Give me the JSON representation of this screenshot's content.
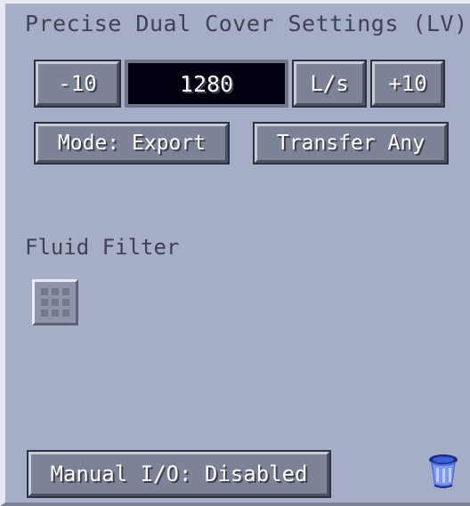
{
  "window": {
    "title": "Precise Dual Cover Settings (LV)"
  },
  "rate": {
    "minus_label": "-10",
    "value": "1280",
    "unit_label": "L/s",
    "plus_label": "+10"
  },
  "modes": {
    "mode_label": "Mode: Export",
    "transfer_label": "Transfer Any"
  },
  "filter": {
    "label": "Fluid Filter",
    "slot_icon": "empty-slot-icon"
  },
  "footer": {
    "manual_io_label": "Manual I/O: Disabled",
    "trash_icon": "trash-can-icon"
  },
  "colors": {
    "panel": "#a6adc6",
    "button": "#7c8396",
    "display_bg": "#000010",
    "text_dark": "#3e4252"
  }
}
